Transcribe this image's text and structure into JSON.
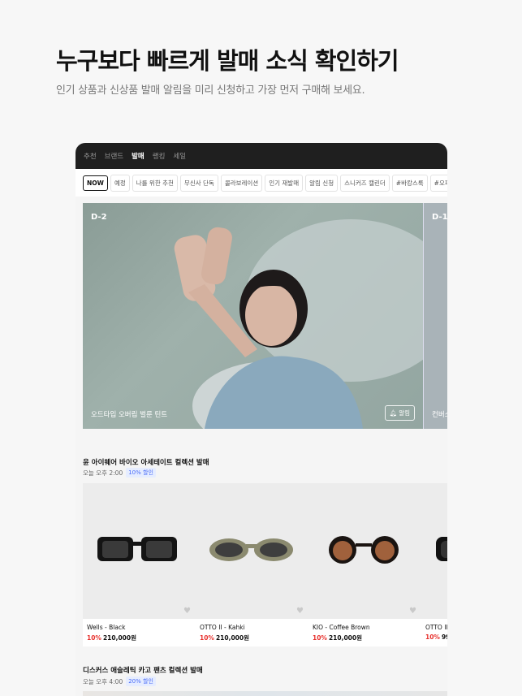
{
  "promo": {
    "title": "누구보다 빠르게 발매 소식 확인하기",
    "subtitle": "인기 상품과 신상품 발매 알림을 미리 신청하고 가장 먼저 구매해 보세요."
  },
  "topnav": [
    "추천",
    "브랜드",
    "발매",
    "랭킹",
    "세일"
  ],
  "chips": [
    "NOW",
    "예정",
    "나를 위한 추천",
    "무신사 단독",
    "콜라보레이션",
    "인기 재발매",
    "알림 신청",
    "스니커즈 캘린더",
    "#바캉스룩",
    "#오피스웨어"
  ],
  "hero": {
    "dday": "D-2",
    "title": "오드타입 오버립 벌룬 틴트",
    "alarm_label": "알림",
    "next_dday": "D-1",
    "next_title": "컨버스"
  },
  "section1": {
    "title": "윤 아이웨어 바이오 아세테이트 컬렉션 발매",
    "time": "오늘 오후 2:00",
    "badge": "10% 할인"
  },
  "products": [
    {
      "name": "Wells - Black",
      "discount": "10%",
      "price": "210,000원",
      "frame_color": "#141414",
      "lens_color": "#3a3a3a"
    },
    {
      "name": "OTTO II - Kahki",
      "discount": "10%",
      "price": "210,000원",
      "frame_color": "#8b8a6f",
      "lens_color": "#3e3e3e"
    },
    {
      "name": "KIO - Coffee Brown",
      "discount": "10%",
      "price": "210,000원",
      "frame_color": "#1a1411",
      "lens_color": "#a0613c"
    },
    {
      "name": "OTTO II",
      "discount": "10%",
      "price": "99",
      "frame_color": "#111111",
      "lens_color": "#333333"
    }
  ],
  "section2": {
    "title": "디스커스 애슬레틱 카고 팬츠 컬렉션 발매",
    "time": "오늘 오후 4:00",
    "badge": "20% 할인"
  }
}
